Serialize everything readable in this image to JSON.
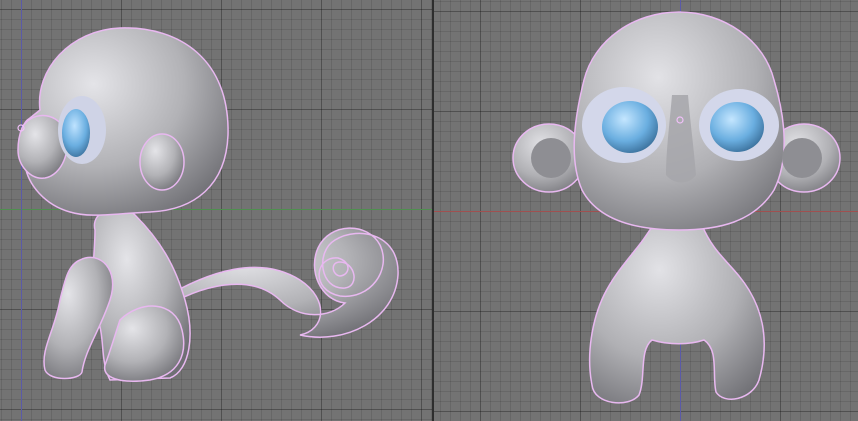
{
  "viewports": [
    {
      "name": "side-view"
    },
    {
      "name": "front-view"
    }
  ],
  "colors": {
    "background": "#737373",
    "grid_minor": "#6a6a6a",
    "grid_major": "#5c5c5c",
    "axis_x_red": "#a05050",
    "axis_y_green": "#4f8f4f",
    "axis_z_blue": "#5a5aa8",
    "mesh": "#b8b8bc",
    "selection_outline": "#e8b8f0",
    "eye_blue": "#6ab0e0"
  },
  "icons": {
    "object_origin": "origin-dot-icon"
  }
}
